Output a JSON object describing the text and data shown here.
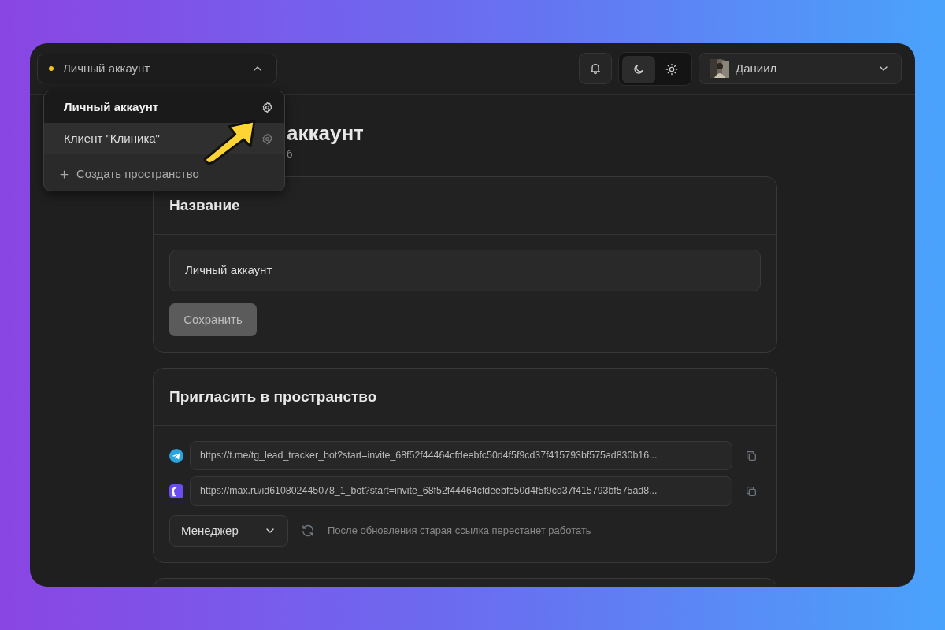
{
  "workspace_selector": {
    "label": "Личный аккаунт",
    "color": "#f5c518",
    "expanded": true
  },
  "workspace_menu": {
    "items": [
      {
        "label": "Личный аккаунт",
        "selected": true
      },
      {
        "label": "Клиент \"Клиника\"",
        "selected": false
      }
    ],
    "create_label": "Создать пространство"
  },
  "header": {
    "theme_options": [
      {
        "kind": "dark",
        "selected": true
      },
      {
        "kind": "light",
        "selected": false
      }
    ],
    "user_name": "Даниил"
  },
  "page": {
    "title": "аккаунт",
    "subtitle": "б"
  },
  "name_card": {
    "title": "Название",
    "value": "Личный аккаунт",
    "save_button": {
      "label": "Сохранить",
      "disabled": true
    }
  },
  "invite_card": {
    "title": "Пригласить в пространство",
    "links": [
      {
        "kind": "telegram",
        "url": "https://t.me/tg_lead_tracker_bot?start=invite_68f52f44464cfdeebfc50d4f5f9cd37f415793bf575ad830b16..."
      },
      {
        "kind": "max",
        "url": "https://max.ru/id610802445078_1_bot?start=invite_68f52f44464cfdeebfc50d4f5f9cd37f415793bf575ad8..."
      }
    ],
    "role": "Менеджер",
    "hint": "После обновления старая ссылка перестанет работать"
  }
}
